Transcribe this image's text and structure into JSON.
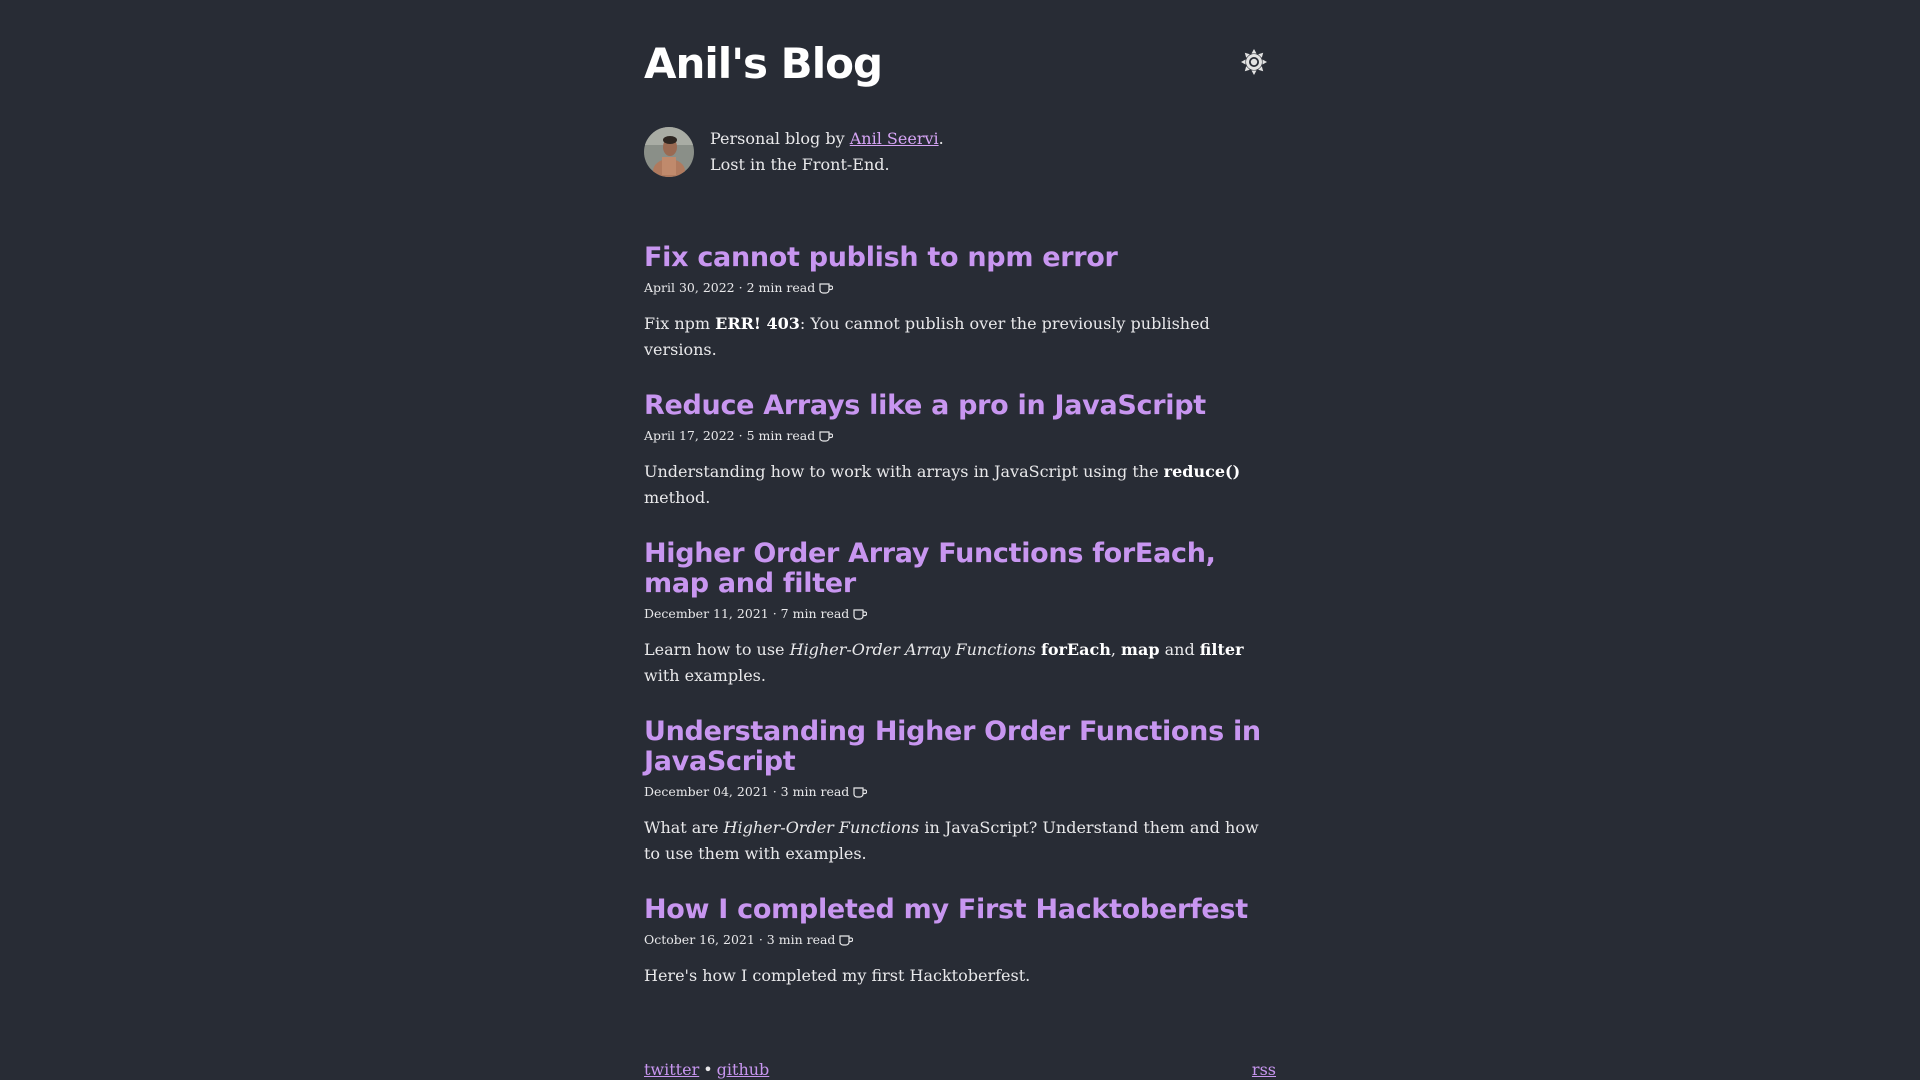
{
  "site": {
    "title": "Anil's Blog"
  },
  "bio": {
    "prefix": "Personal blog by ",
    "author_name": "Anil Seervi",
    "suffix": ".",
    "tagline": "Lost in the Front-End."
  },
  "posts": [
    {
      "title": "Fix cannot publish to npm error",
      "date": "April 30, 2022",
      "read_time": "2 min read",
      "desc_1": "Fix npm ",
      "desc_bold_1": "ERR! 403",
      "desc_2": ": You cannot publish over the previously published versions."
    },
    {
      "title": "Reduce Arrays like a pro in JavaScript",
      "date": "April 17, 2022",
      "read_time": "5 min read",
      "desc_1": "Understanding how to work with arrays in JavaScript using the ",
      "desc_bold_1": "reduce()",
      "desc_2": " method."
    },
    {
      "title": "Higher Order Array Functions forEach, map and filter",
      "date": "December 11, 2021",
      "read_time": "7 min read",
      "desc_1": "Learn how to use ",
      "desc_italic_1": "Higher-Order Array Functions",
      "desc_2": " ",
      "desc_bold_1": "forEach",
      "desc_3": ", ",
      "desc_bold_2": "map",
      "desc_4": " and ",
      "desc_bold_3": "filter",
      "desc_5": " with examples."
    },
    {
      "title": "Understanding Higher Order Functions in JavaScript",
      "date": "December 04, 2021",
      "read_time": "3 min read",
      "desc_1": "What are ",
      "desc_italic_1": "Higher-Order Functions",
      "desc_2": " in JavaScript? Understand them and how to use them with examples."
    },
    {
      "title": "How I completed my First Hacktoberfest",
      "date": "October 16, 2021",
      "read_time": "3 min read",
      "desc_1": "Here's how I completed my first Hacktoberfest."
    }
  ],
  "meta_separator": "·",
  "footer": {
    "twitter": "twitter",
    "separator": "•",
    "github": "github",
    "rss": "rss"
  },
  "colors": {
    "background": "#282c35",
    "accent": "#c896f0",
    "text": "#e8e8ea"
  },
  "icons": {
    "theme_toggle": "sun-icon",
    "read_time": "coffee-cup-icon"
  }
}
